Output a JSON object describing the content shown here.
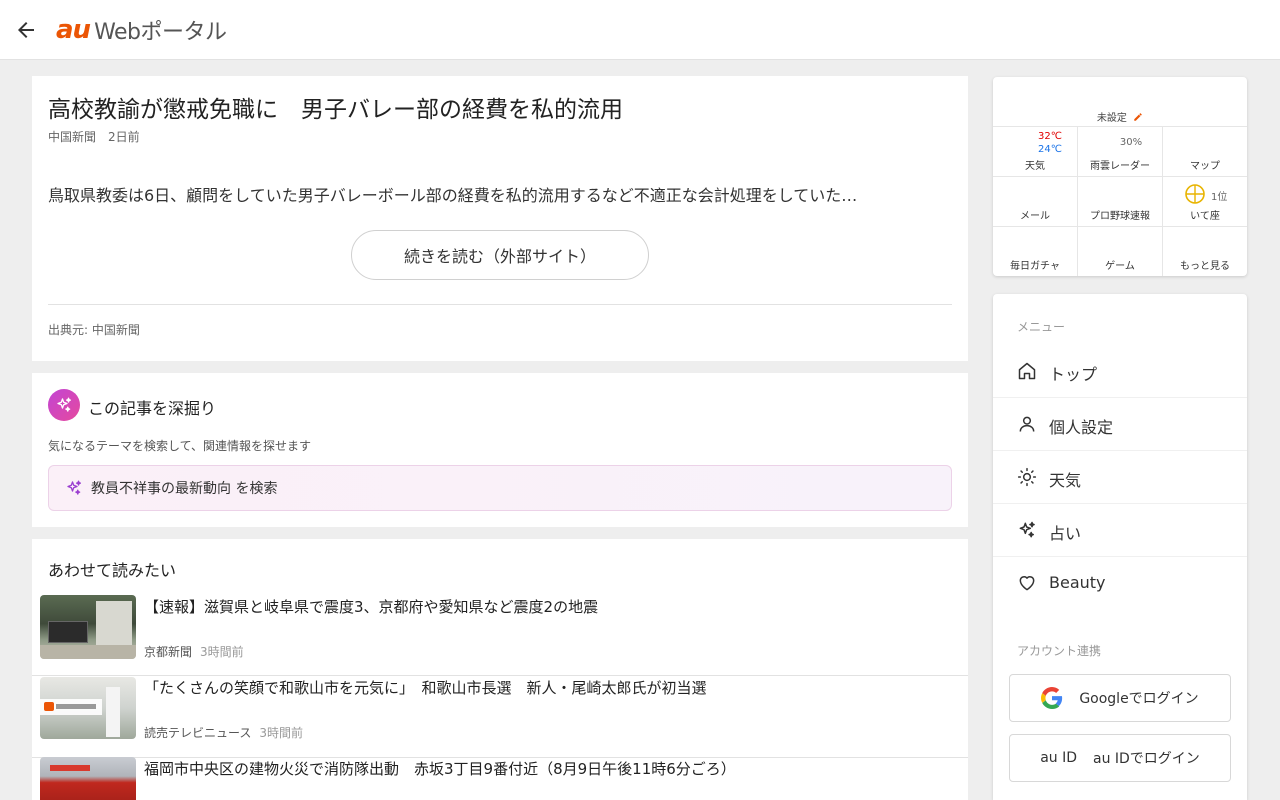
{
  "header": {
    "logo_au": "au",
    "logo_text": "Webポータル"
  },
  "article": {
    "title": "高校教諭が懲戒免職に　男子バレー部の経費を私的流用",
    "source": "中国新聞",
    "time": "2日前",
    "excerpt": "鳥取県教委は6日、顧問をしていた男子バレーボール部の経費を私的流用するなど不適正な会計処理をしていた…",
    "read_more": "続きを読む（外部サイト）",
    "credit": "出典元: 中国新聞"
  },
  "deep_dive": {
    "title": "この記事を深掘り",
    "subtitle": "気になるテーマを検索して、関連情報を探せます",
    "search_text": "教員不祥事の最新動向 を検索"
  },
  "related": {
    "heading": "あわせて読みたい",
    "items": [
      {
        "title": "【速報】滋賀県と岐阜県で震度3、京都府や愛知県など震度2の地震",
        "source": "京都新聞",
        "time": "3時間前"
      },
      {
        "title": "「たくさんの笑顔で和歌山市を元気に」　和歌山市長選　新人・尾崎太郎氏が初当選",
        "source": "読売テレビニュース",
        "time": "3時間前"
      },
      {
        "title": "福岡市中央区の建物火災で消防隊出動　赤坂3丁目9番付近（8月9日午後11時6分ごろ）",
        "source": "",
        "time": ""
      }
    ]
  },
  "widget": {
    "location": "未設定",
    "weather": {
      "high": "32℃",
      "low": "24℃",
      "label": "天気"
    },
    "radar": {
      "value": "30%",
      "label": "雨雲レーダー"
    },
    "map": {
      "label": "マップ"
    },
    "mail": {
      "label": "メール"
    },
    "baseball": {
      "label": "プロ野球速報"
    },
    "horoscope": {
      "rank": "1位",
      "label": "いて座"
    },
    "gacha": {
      "label": "毎日ガチャ"
    },
    "game": {
      "label": "ゲーム"
    },
    "more": {
      "label": "もっと見る"
    }
  },
  "menu": {
    "heading": "メニュー",
    "items": [
      {
        "label": "トップ",
        "icon": "home-icon"
      },
      {
        "label": "個人設定",
        "icon": "person-icon"
      },
      {
        "label": "天気",
        "icon": "sun-icon"
      },
      {
        "label": "占い",
        "icon": "sparkle-icon"
      },
      {
        "label": "Beauty",
        "icon": "heart-icon"
      }
    ],
    "account_heading": "アカウント連携",
    "google_login": "Googleでログイン",
    "auid_alt": "au ID",
    "auid_login": "au IDでログイン"
  },
  "colors": {
    "accent": "#eb5505",
    "temp_high": "#e00000",
    "temp_low": "#1a73e8",
    "deep_dive_gradient_start": "#c244d4",
    "deep_dive_gradient_end": "#e54a9e"
  }
}
